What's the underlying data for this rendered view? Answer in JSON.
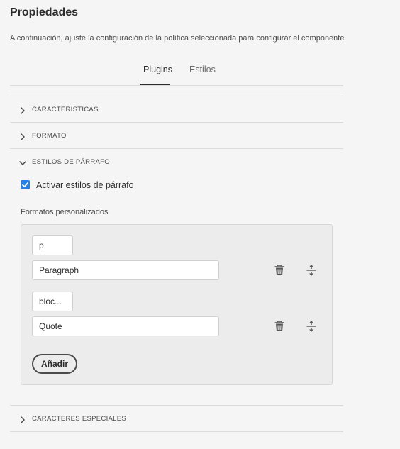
{
  "page": {
    "title": "Propiedades",
    "description": "A continuación, ajuste la configuración de la política seleccionada para configurar el componente"
  },
  "tabs": [
    {
      "label": "Plugins",
      "active": true
    },
    {
      "label": "Estilos",
      "active": false
    }
  ],
  "accordion": {
    "caracteristicas": "CARACTERÍSTICAS",
    "formato": "FORMATO",
    "estilos_parrafo": "ESTILOS DE PÁRRAFO",
    "caracteres_especiales": "CARACTERES ESPECIALES"
  },
  "paragraph_styles": {
    "enable_label": "Activar estilos de párrafo",
    "enable_checked": true,
    "custom_formats_label": "Formatos personalizados",
    "formats": [
      {
        "element": "p",
        "description": "Paragraph"
      },
      {
        "element": "bloc...",
        "description": "Quote"
      }
    ],
    "add_label": "Añadir"
  },
  "icons": {
    "delete": "trash-icon",
    "move": "drag-handle-icon",
    "collapsed": "chevron-right-icon",
    "expanded": "chevron-down-icon"
  },
  "colors": {
    "accent": "#2680eb",
    "text": "#2c2c2c",
    "background": "#f5f5f5"
  }
}
